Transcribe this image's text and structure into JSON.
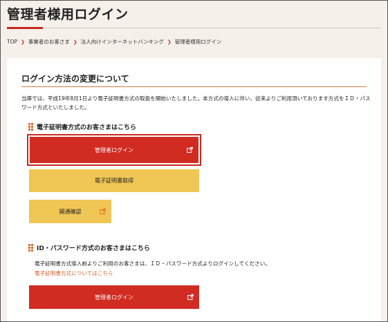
{
  "page": {
    "title": "管理者様用ログイン"
  },
  "breadcrumb": {
    "items": [
      "TOP",
      "事業者のお客さま",
      "法人向けインターネットバンキング"
    ],
    "current": "管理者様用ログイン"
  },
  "card": {
    "title": "ログイン方法の変更について",
    "notice": "当庫では、平成19年8月1日より電子証明書方式の取扱を開始いたしました。本方式の導入に伴い、従来よりご利用頂いております方式をＩＤ・パスワード方式といたしました。"
  },
  "cert_section": {
    "heading": "電子証明書方式のお客さまはこちら",
    "login_button": "管理者ログイン",
    "get_cert_button": "電子証明書取得",
    "check_button": "開通確認"
  },
  "id_section": {
    "heading": "ID・パスワード方式のお客さまはこちら",
    "description": "電子証明書方式導入前よりご利用のお客さまは、ＩＤ・パスワード方式よりログインしてください。",
    "link": "電子証明書方式についてはこちら",
    "login_button": "管理者ログイン"
  },
  "colors": {
    "accent_red": "#d02c22",
    "button_yellow": "#f0c655",
    "link_orange": "#d4602a"
  }
}
